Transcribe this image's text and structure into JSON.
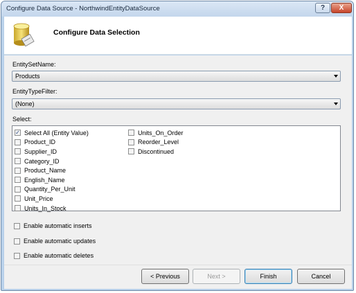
{
  "window": {
    "title": "Configure Data Source - NorthwindEntityDataSource"
  },
  "header": {
    "title": "Configure Data Selection"
  },
  "entity_set": {
    "label": "EntitySetName:",
    "value": "Products"
  },
  "type_filter": {
    "label": "EntityTypeFilter:",
    "value": "(None)"
  },
  "select": {
    "label": "Select:",
    "column1": [
      {
        "label": "Select All (Entity Value)",
        "checked": true
      },
      {
        "label": "Product_ID",
        "checked": false
      },
      {
        "label": "Supplier_ID",
        "checked": false
      },
      {
        "label": "Category_ID",
        "checked": false
      },
      {
        "label": "Product_Name",
        "checked": false
      },
      {
        "label": "English_Name",
        "checked": false
      },
      {
        "label": "Quantity_Per_Unit",
        "checked": false
      },
      {
        "label": "Unit_Price",
        "checked": false
      },
      {
        "label": "Units_In_Stock",
        "checked": false
      }
    ],
    "column2": [
      {
        "label": "Units_On_Order",
        "checked": false
      },
      {
        "label": "Reorder_Level",
        "checked": false
      },
      {
        "label": "Discontinued",
        "checked": false
      }
    ]
  },
  "options": {
    "inserts": {
      "label": "Enable automatic inserts",
      "checked": false
    },
    "updates": {
      "label": "Enable automatic updates",
      "checked": false
    },
    "deletes": {
      "label": "Enable automatic deletes",
      "checked": false
    }
  },
  "footer": {
    "previous": "< Previous",
    "next": "Next >",
    "finish": "Finish",
    "cancel": "Cancel"
  },
  "titlebar_buttons": {
    "help": "?",
    "close": "X"
  },
  "colors": {
    "frame": "#b9d1ea",
    "panel": "#f0f0f0",
    "check": "#1c3d7a"
  }
}
